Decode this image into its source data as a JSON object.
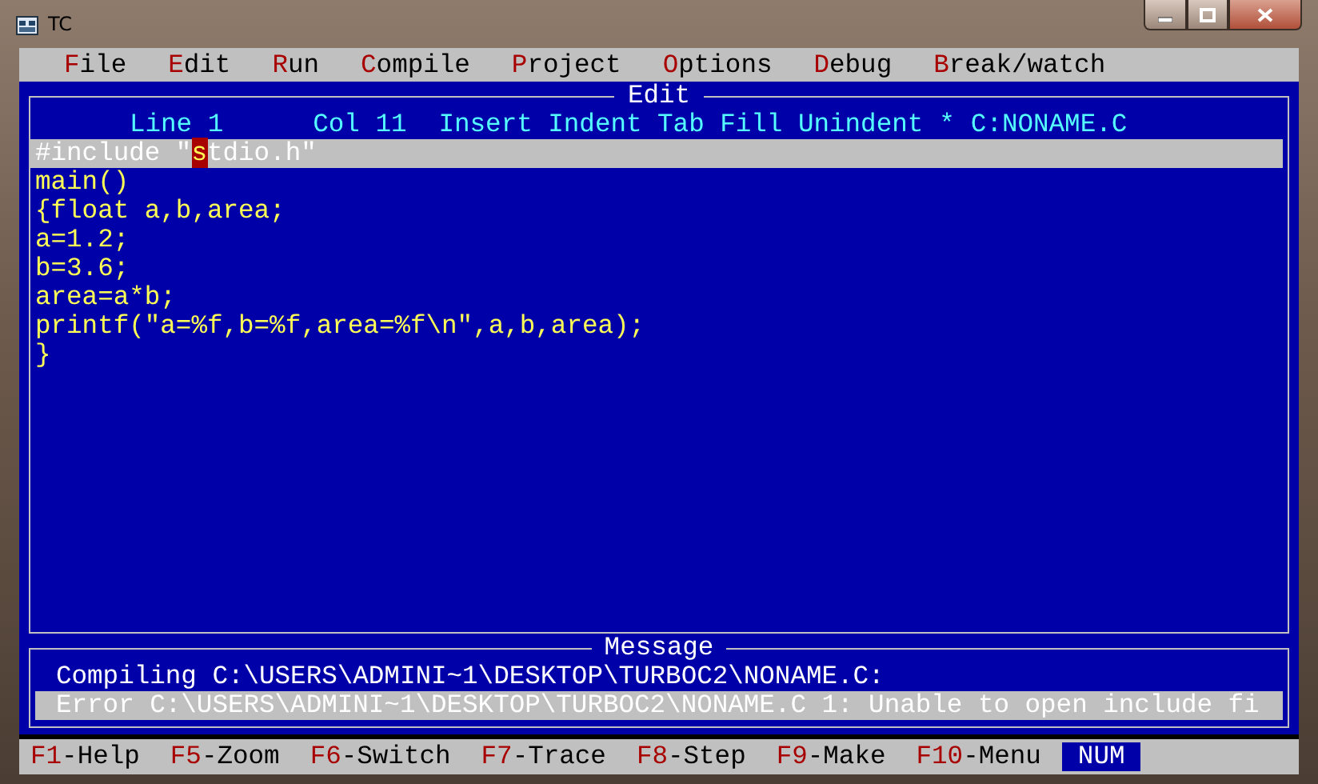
{
  "window": {
    "title": "TC"
  },
  "menu": [
    {
      "label": "File"
    },
    {
      "label": "Edit"
    },
    {
      "label": "Run"
    },
    {
      "label": "Compile"
    },
    {
      "label": "Project"
    },
    {
      "label": "Options"
    },
    {
      "label": "Debug"
    },
    {
      "label": "Break/watch"
    }
  ],
  "editor": {
    "title": "Edit",
    "status": {
      "line": "Line 1",
      "col": "Col 11",
      "modes": "Insert Indent Tab Fill Unindent",
      "modified": "*",
      "file": "C:NONAME.C"
    },
    "lines": [
      {
        "before": "#include \"",
        "cursor": "s",
        "after": "tdio.h\"",
        "highlighted": true
      },
      {
        "text": "main()",
        "highlighted": false
      },
      {
        "text": "{float a,b,area;",
        "highlighted": false
      },
      {
        "text": "a=1.2;",
        "highlighted": false
      },
      {
        "text": "b=3.6;",
        "highlighted": false
      },
      {
        "text": "area=a*b;",
        "highlighted": false
      },
      {
        "text": "printf(\"a=%f,b=%f,area=%f\\n\",a,b,area);",
        "highlighted": false
      },
      {
        "text": "}",
        "highlighted": false
      }
    ]
  },
  "message": {
    "title": "Message",
    "lines": [
      {
        "text": "Compiling C:\\USERS\\ADMINI~1\\DESKTOP\\TURBOC2\\NONAME.C:",
        "highlighted": false
      },
      {
        "text": "Error C:\\USERS\\ADMINI~1\\DESKTOP\\TURBOC2\\NONAME.C 1: Unable to open include fi",
        "highlighted": true
      }
    ]
  },
  "function_keys": [
    {
      "key": "F1",
      "label": "-Help"
    },
    {
      "key": "F5",
      "label": "-Zoom"
    },
    {
      "key": "F6",
      "label": "-Switch"
    },
    {
      "key": "F7",
      "label": "-Trace"
    },
    {
      "key": "F8",
      "label": "-Step"
    },
    {
      "key": "F9",
      "label": "-Make"
    },
    {
      "key": "F10",
      "label": "-Menu"
    }
  ],
  "indicator": "NUM"
}
